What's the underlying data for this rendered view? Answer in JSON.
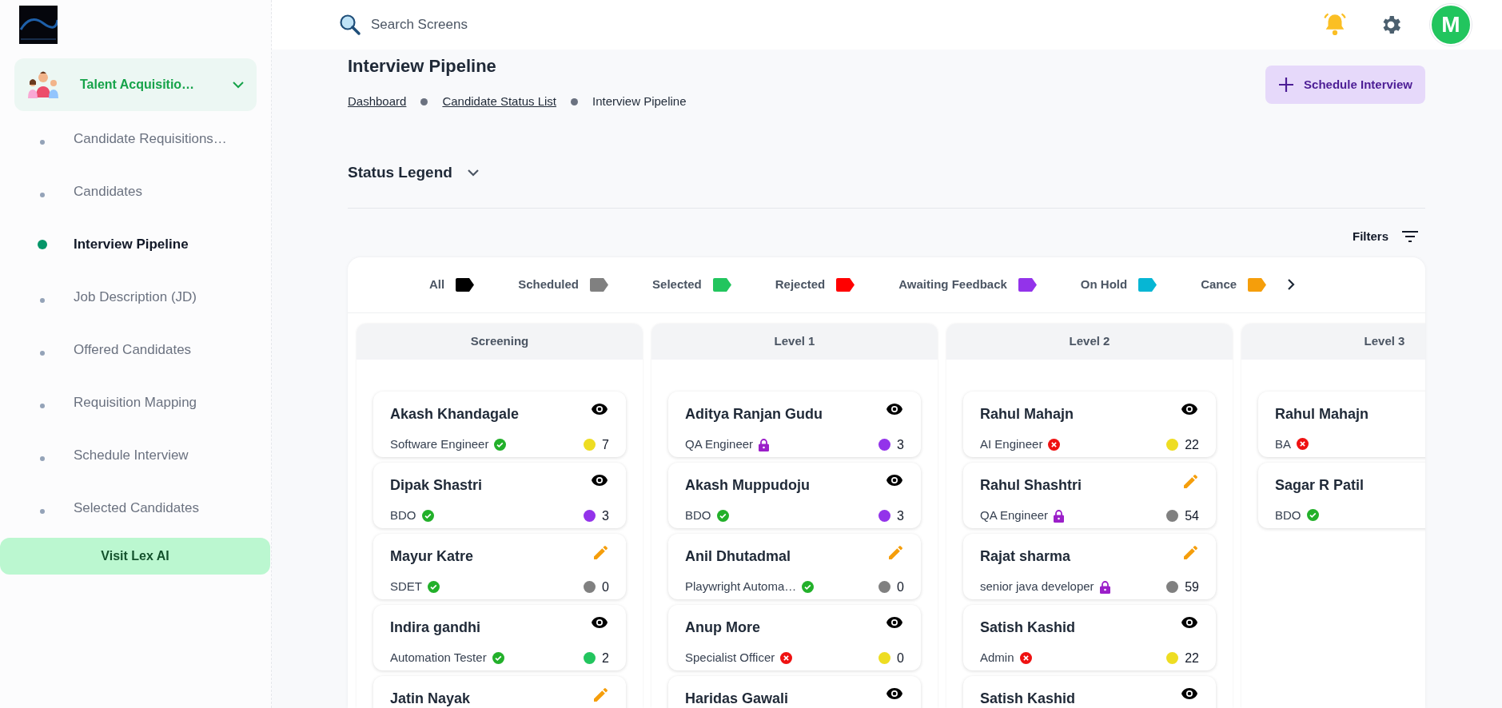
{
  "sidebar": {
    "group": {
      "label": "Talent Acquisitio…",
      "expanded": true
    },
    "items": [
      {
        "label": "Candidate Requisitions…",
        "selected": false
      },
      {
        "label": "Candidates",
        "selected": false
      },
      {
        "label": "Interview Pipeline",
        "selected": true
      },
      {
        "label": "Job Description (JD)",
        "selected": false
      },
      {
        "label": "Offered Candidates",
        "selected": false
      },
      {
        "label": "Requisition Mapping",
        "selected": false
      },
      {
        "label": "Schedule Interview",
        "selected": false
      },
      {
        "label": "Selected Candidates",
        "selected": false
      }
    ],
    "button": "Visit Lex AI"
  },
  "header": {
    "search": {
      "placeholder": "Search Screens"
    },
    "avatar": "M"
  },
  "page": {
    "title": "Interview Pipeline",
    "breadcrumbs": [
      {
        "label": "Dashboard",
        "link": true
      },
      {
        "label": "Candidate Status List",
        "link": true
      },
      {
        "label": "Interview Pipeline",
        "link": false
      }
    ],
    "action": "Schedule Interview",
    "legend_title": "Status Legend",
    "filters": "Filters"
  },
  "legend": [
    {
      "label": "All",
      "color": "#000000"
    },
    {
      "label": "Scheduled",
      "color": "#808080"
    },
    {
      "label": "Selected",
      "color": "#22c55e"
    },
    {
      "label": "Rejected",
      "color": "#ff0000"
    },
    {
      "label": "Awaiting Feedback",
      "color": "#9333ea"
    },
    {
      "label": "On Hold",
      "color": "#06b6d4"
    },
    {
      "label": "Cance",
      "color": "#f59e0b"
    }
  ],
  "columns": [
    {
      "title": "Screening",
      "cards": [
        {
          "name": "Akash Khandagale",
          "role": "Software Engineer",
          "kind": "ok",
          "editable": false,
          "color": "#eedd22",
          "count": "7"
        },
        {
          "name": "Dipak Shastri",
          "role": "BDO",
          "kind": "ok",
          "editable": false,
          "color": "#9333ea",
          "count": "3"
        },
        {
          "name": "Mayur Katre",
          "role": "SDET",
          "kind": "ok",
          "editable": true,
          "color": "#808080",
          "count": "0"
        },
        {
          "name": "Indira gandhi",
          "role": "Automation Tester",
          "kind": "ok",
          "editable": false,
          "color": "#22c55e",
          "count": "2"
        },
        {
          "name": "Jatin Nayak",
          "editable": true
        }
      ]
    },
    {
      "title": "Level 1",
      "cards": [
        {
          "name": "Aditya Ranjan Gudu",
          "role": "QA Engineer",
          "kind": "locked",
          "editable": false,
          "color": "#9333ea",
          "count": "3"
        },
        {
          "name": "Akash Muppudoju",
          "role": "BDO",
          "kind": "ok",
          "editable": false,
          "color": "#9333ea",
          "count": "3"
        },
        {
          "name": "Anil Dhutadmal",
          "role": "Playwright Automa…",
          "kind": "ok",
          "editable": true,
          "color": "#808080",
          "count": "0"
        },
        {
          "name": "Anup More",
          "role": "Specialist Officer",
          "kind": "rejected",
          "editable": false,
          "color": "#eedd22",
          "count": "0"
        },
        {
          "name": "Haridas Gawali",
          "editable": false
        }
      ]
    },
    {
      "title": "Level 2",
      "cards": [
        {
          "name": "Rahul Mahajn",
          "role": "AI Engineer",
          "kind": "rejected",
          "editable": false,
          "color": "#eedd22",
          "count": "22"
        },
        {
          "name": "Rahul Shashtri",
          "role": "QA Engineer",
          "kind": "locked",
          "editable": true,
          "color": "#808080",
          "count": "54"
        },
        {
          "name": "Rajat sharma",
          "role": "senior java developer",
          "kind": "locked",
          "editable": true,
          "color": "#808080",
          "count": "59"
        },
        {
          "name": "Satish Kashid",
          "role": "Admin",
          "kind": "rejected",
          "editable": false,
          "color": "#eedd22",
          "count": "22"
        },
        {
          "name": "Satish Kashid",
          "editable": false
        }
      ]
    },
    {
      "title": "Level 3",
      "cards": [
        {
          "name": "Rahul Mahajn",
          "role": "BA",
          "kind": "rejected"
        },
        {
          "name": "Sagar R Patil",
          "role": "BDO",
          "kind": "ok"
        }
      ]
    }
  ]
}
